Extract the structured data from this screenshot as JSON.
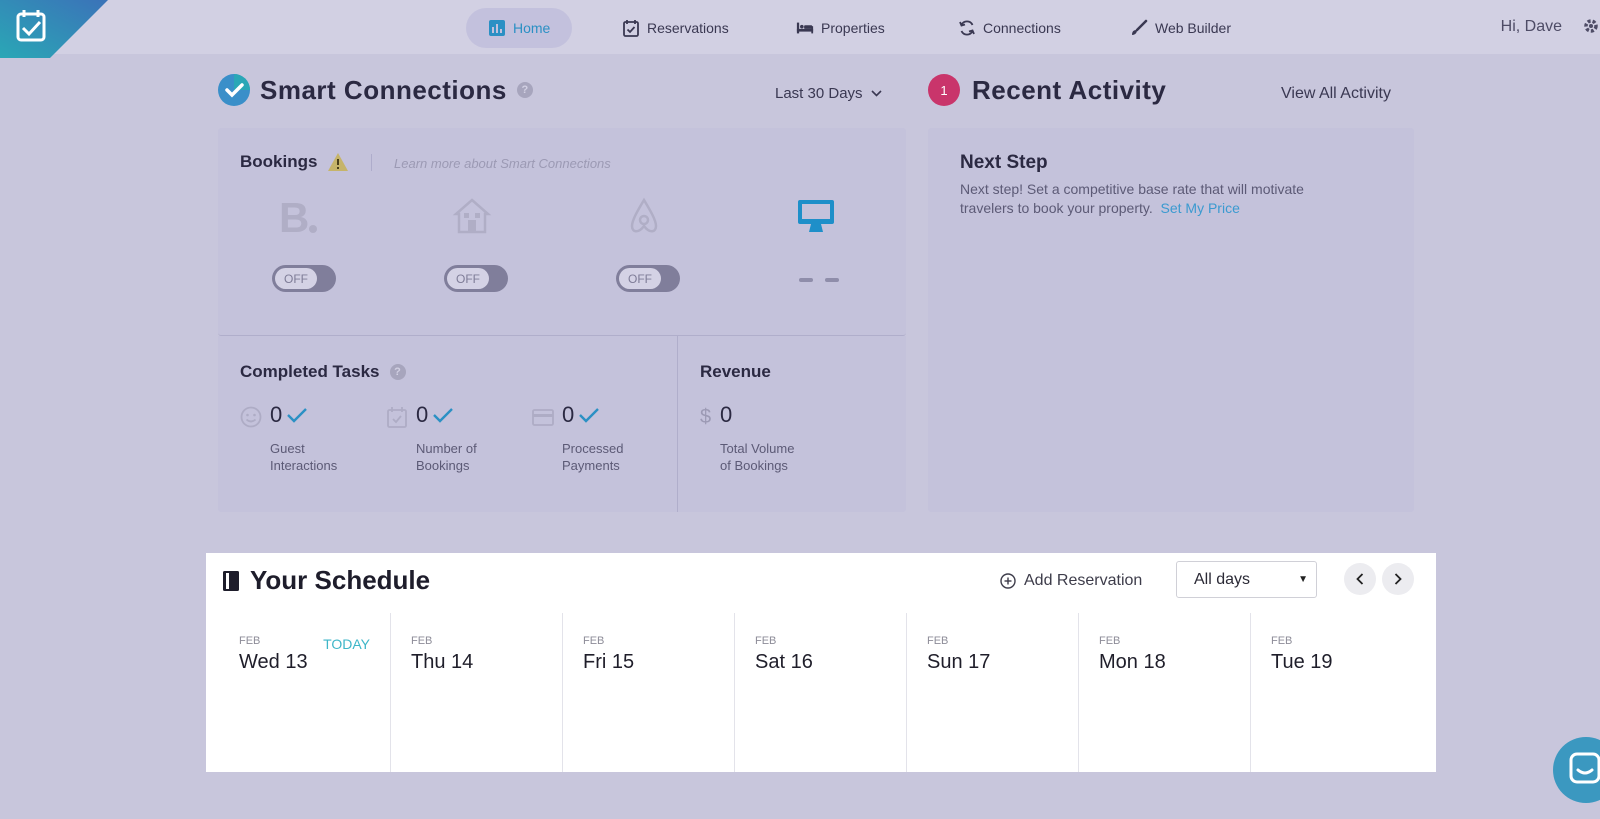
{
  "nav": {
    "items": [
      {
        "label": "Home",
        "icon": "bar-chart-icon",
        "active": true
      },
      {
        "label": "Reservations",
        "icon": "calendar-check-icon"
      },
      {
        "label": "Properties",
        "icon": "bed-icon"
      },
      {
        "label": "Connections",
        "icon": "sync-icon"
      },
      {
        "label": "Web Builder",
        "icon": "brush-icon"
      }
    ],
    "greeting": "Hi, Dave"
  },
  "smart_connections": {
    "title": "Smart Connections",
    "help": "?",
    "range": "Last 30 Days",
    "bookings": {
      "title": "Bookings",
      "learn_more": "Learn more about Smart Connections",
      "channels": [
        {
          "icon": "booking-com-icon",
          "state": "OFF"
        },
        {
          "icon": "homeaway-icon",
          "state": "OFF"
        },
        {
          "icon": "airbnb-icon",
          "state": "OFF"
        },
        {
          "icon": "website-monitor-icon",
          "state": "-- "
        }
      ]
    },
    "completed_tasks": {
      "title": "Completed Tasks",
      "help": "?",
      "stats": [
        {
          "value": "0",
          "label_1": "Guest",
          "label_2": "Interactions"
        },
        {
          "value": "0",
          "label_1": "Number of",
          "label_2": "Bookings"
        },
        {
          "value": "0",
          "label_1": "Processed",
          "label_2": "Payments"
        }
      ]
    },
    "revenue": {
      "title": "Revenue",
      "currency": "$",
      "value": "0",
      "label_1": "Total Volume",
      "label_2": "of Bookings"
    }
  },
  "recent_activity": {
    "badge": "1",
    "title": "Recent Activity",
    "view_all": "View All Activity",
    "next_step": {
      "title": "Next Step",
      "text": "Next step! Set a competitive base rate that will motivate travelers to book your property.",
      "link": "Set My Price"
    }
  },
  "schedule": {
    "title": "Your Schedule",
    "add_reservation": "Add Reservation",
    "filter_value": "All days",
    "today_label": "TODAY",
    "days": [
      {
        "month": "FEB",
        "day": "Wed 13",
        "today": true
      },
      {
        "month": "FEB",
        "day": "Thu 14"
      },
      {
        "month": "FEB",
        "day": "Fri 15"
      },
      {
        "month": "FEB",
        "day": "Sat 16"
      },
      {
        "month": "FEB",
        "day": "Sun 17"
      },
      {
        "month": "FEB",
        "day": "Mon 18"
      },
      {
        "month": "FEB",
        "day": "Tue 19"
      }
    ]
  },
  "colors": {
    "accent": "#3b9ad0",
    "badge": "#c9356b",
    "today": "#3eb6c8",
    "backdrop": "#c8c6dc"
  }
}
